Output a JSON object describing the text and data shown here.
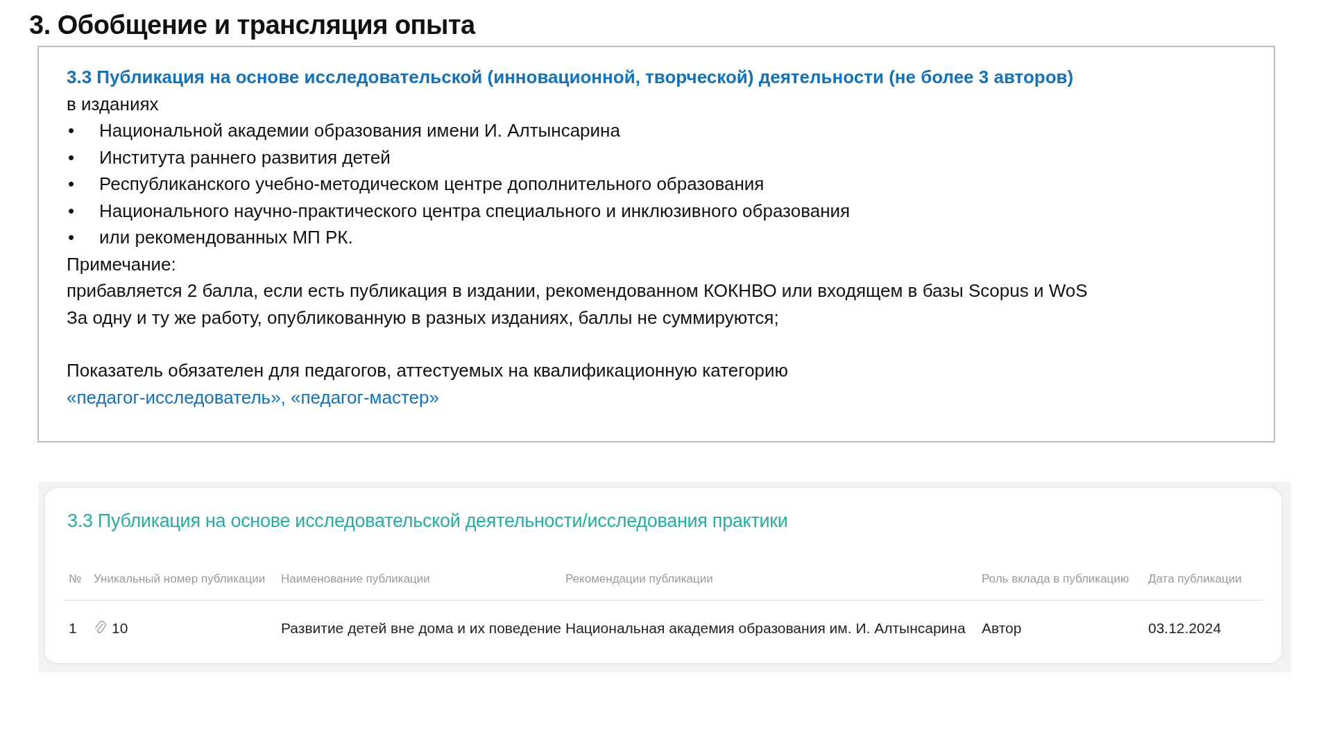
{
  "slide_title": "3. Обобщение и трансляция опыта",
  "criteria": {
    "heading": "3.3 Публикация на основе исследовательской (инновационной, творческой) деятельности (не более 3 авторов)",
    "intro": "в изданиях",
    "bullets": [
      {
        "marker": "•",
        "text": "Национальной академии образования имени И. Алтынсарина"
      },
      {
        "marker": "•",
        "text": "Института раннего развития детей"
      },
      {
        "marker": "•",
        "text": "Республиканского учебно-методическом центре дополнительного образования"
      },
      {
        "marker": "•",
        "text": "Национального научно-практического центра специального и инклюзивного образования"
      },
      {
        "marker": "•",
        "text": "или рекомендованных МП РК."
      }
    ],
    "note_label": "Примечание:",
    "note_lines": [
      "прибавляется 2 балла, если есть публикация в издании, рекомендованном КОКНВО или входящем в базы Scopus и WoS",
      "За одну и ту же работу, опубликованную в разных изданиях, баллы не суммируются;"
    ],
    "requirement": "Показатель обязателен для педагогов, аттестуемых на квалификационную категорию",
    "categories": "«педагог-исследователь», «педагог-мастер»"
  },
  "publications": {
    "title": "3.3 Публикация на основе исследовательской деятельности/исследования практики",
    "columns": [
      "№",
      "Уникальный номер публикации",
      "Наименование публикации",
      "Рекомендации публикации",
      "Роль вклада в публикацию",
      "Дата публикации"
    ],
    "rows": [
      {
        "number": "1",
        "unique_number": "10",
        "name": "Развитие детей вне дома и их поведение",
        "recommendation": "Национальная академия образования им. И. Алтынсарина",
        "role": "Автор",
        "date": "03.12.2024"
      }
    ]
  }
}
